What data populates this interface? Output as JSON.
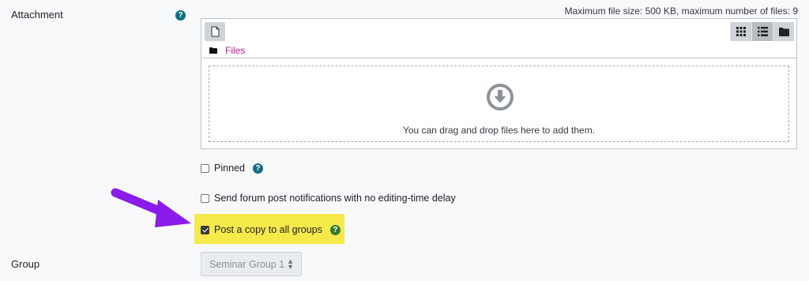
{
  "attachment": {
    "label": "Attachment",
    "help_icon": "question-circle-icon",
    "max_info": "Maximum file size: 500 KB, maximum number of files: 9"
  },
  "filemanager": {
    "add_icon": "file-icon",
    "view_buttons": [
      "grid-view-icon",
      "list-view-icon",
      "folder-tree-icon"
    ],
    "path_icon": "folder-icon",
    "path_label": "Files",
    "drop_icon": "arrow-circle-down-icon",
    "drop_text": "You can drag and drop files here to add them."
  },
  "options": {
    "pinned_label": "Pinned",
    "pinned_checked": false,
    "no_delay_label": "Send forum post notifications with no editing-time delay",
    "no_delay_checked": false,
    "post_copy_label": "Post a copy to all groups",
    "post_copy_checked": true
  },
  "group": {
    "label": "Group",
    "selected": "Seminar Group 1"
  },
  "colors": {
    "accent_link": "#c01a8e",
    "highlight": "#f6e94a",
    "arrow": "#8a1bea",
    "help_teal": "#0f6e84",
    "help_green": "#357a32"
  }
}
